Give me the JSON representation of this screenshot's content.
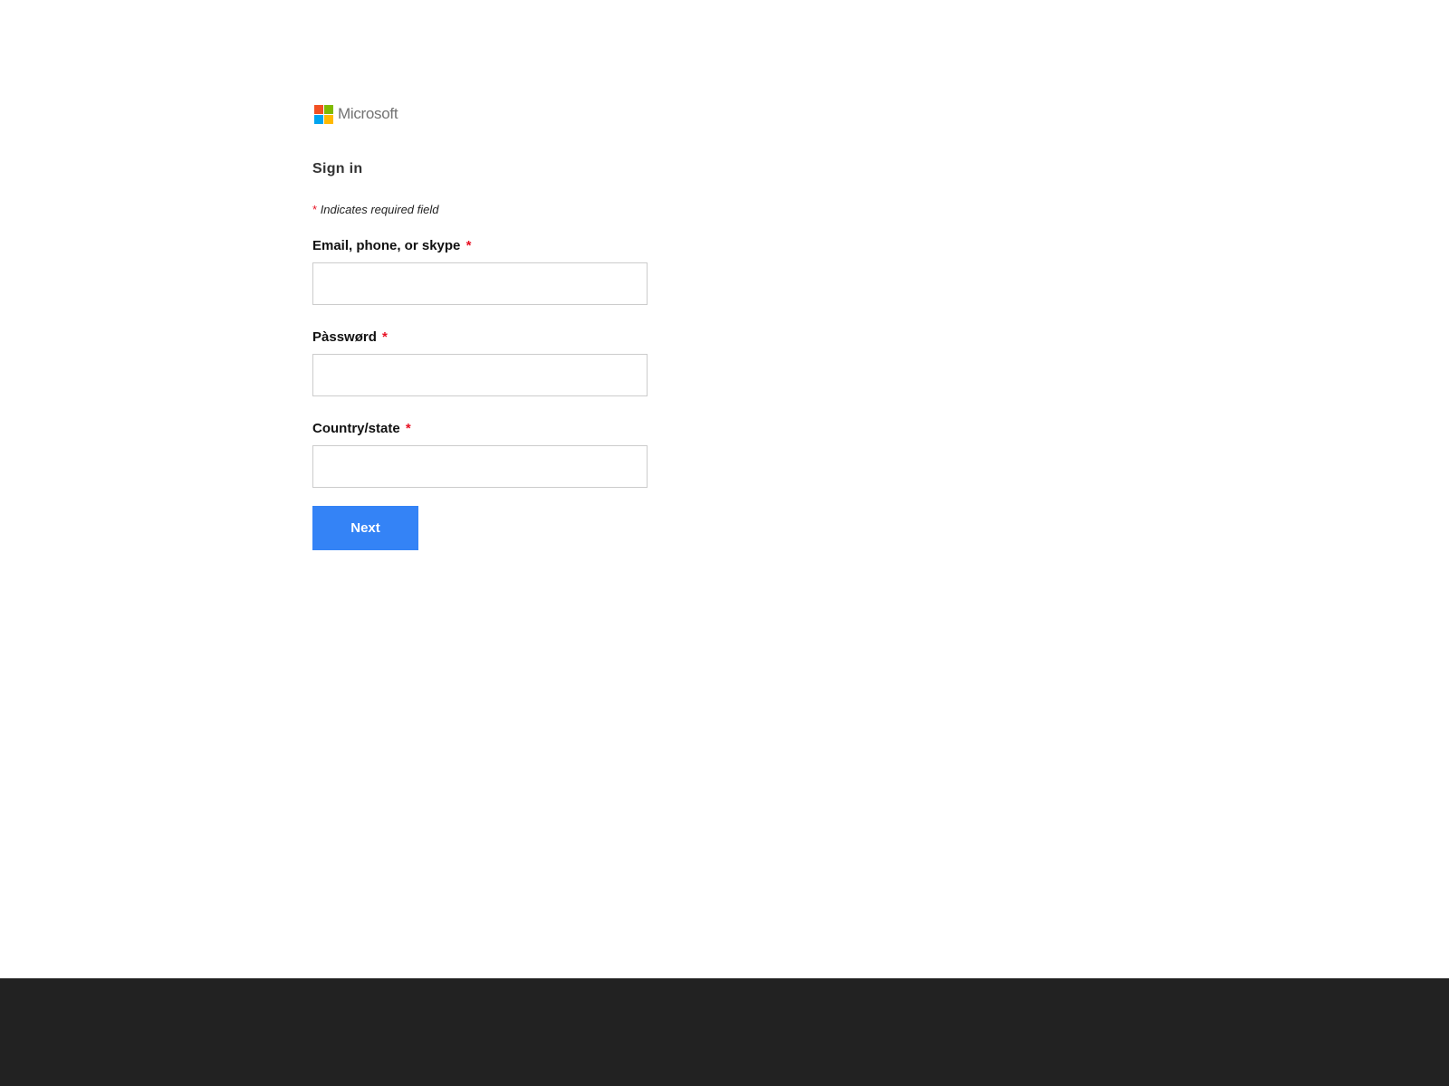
{
  "brand": {
    "name": "Microsoft",
    "logo_colors": [
      "#f25022",
      "#7fba00",
      "#00a4ef",
      "#ffb900"
    ],
    "text_color": "#737373"
  },
  "form": {
    "title": "Sign in",
    "required_marker": "*",
    "required_note": "Indicates required field",
    "fields": [
      {
        "label": "Email, phone, or skype",
        "value": "",
        "placeholder": ""
      },
      {
        "label": "Pàsswørd",
        "value": "",
        "placeholder": ""
      },
      {
        "label": "Country/state",
        "value": "",
        "placeholder": ""
      }
    ],
    "submit_label": "Next"
  },
  "colors": {
    "accent": "#3483f6",
    "required": "#e81123",
    "footer": "#222222"
  }
}
